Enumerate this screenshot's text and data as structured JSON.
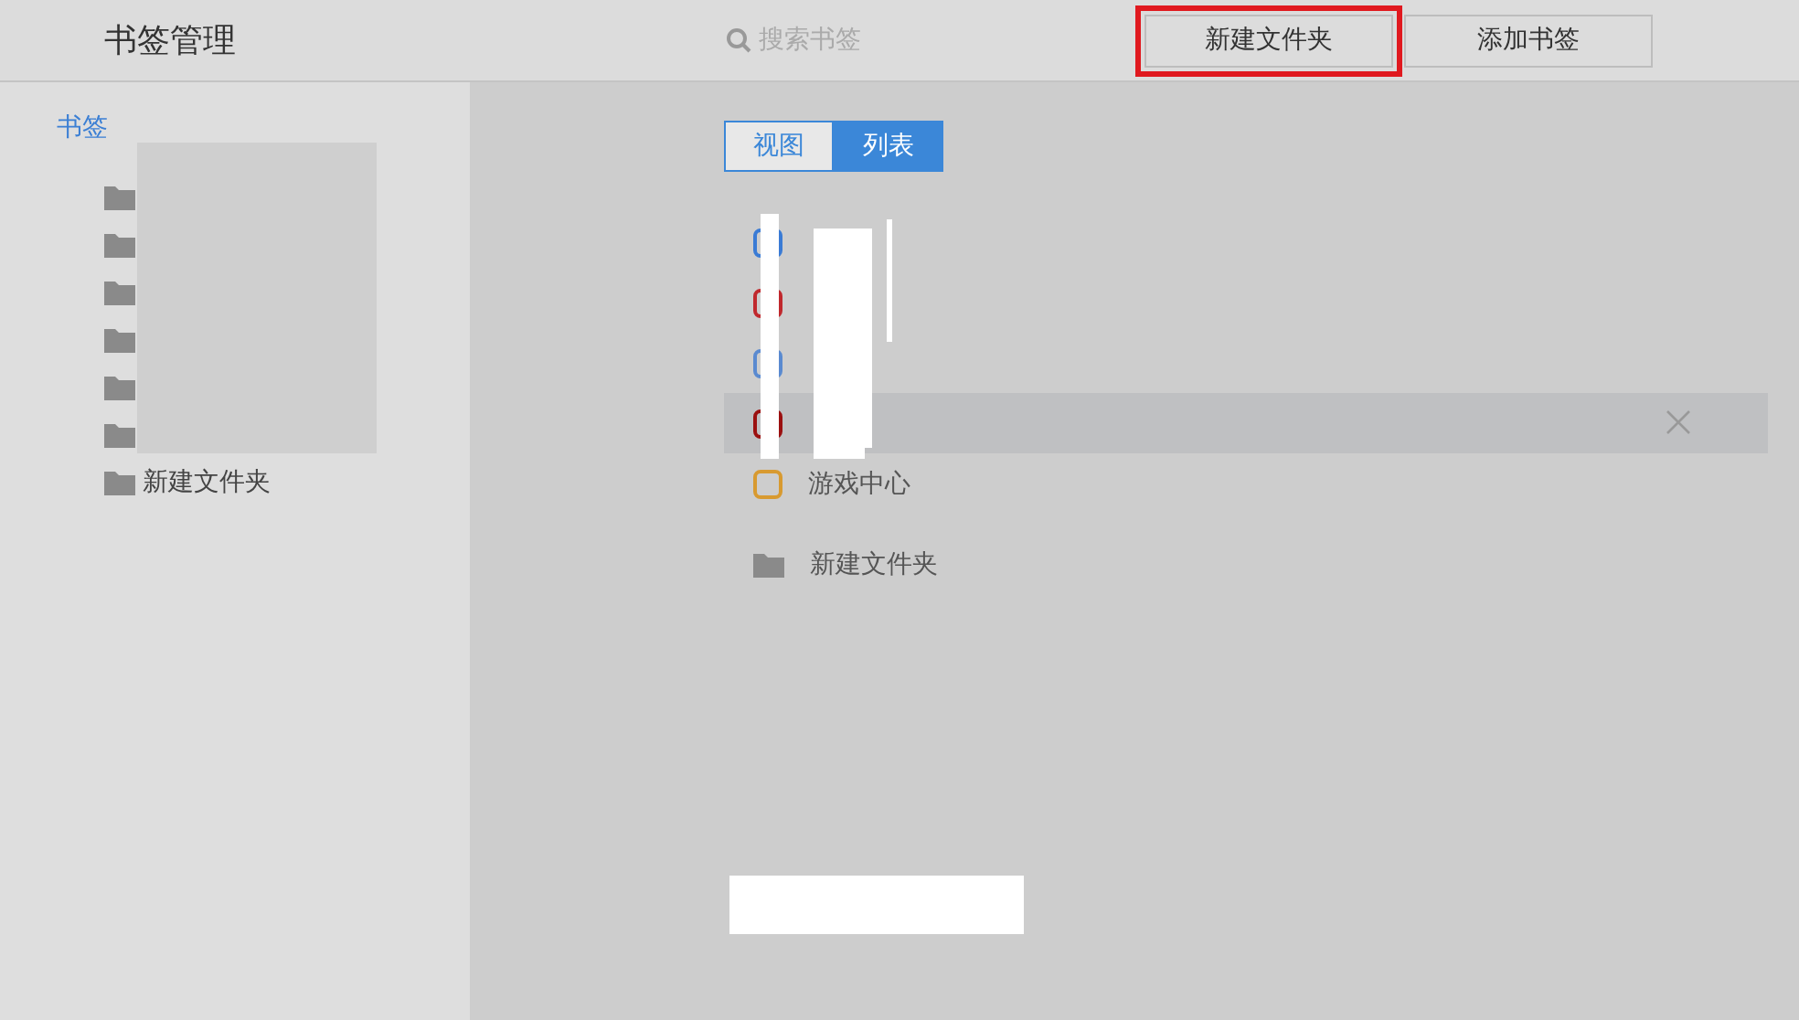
{
  "header": {
    "title": "书签管理",
    "search": {
      "placeholder": "搜索书签"
    },
    "buttons": [
      {
        "label": "新建文件夹",
        "highlighted": true
      },
      {
        "label": "添加书签",
        "highlighted": false
      }
    ]
  },
  "sidebar": {
    "root": "书签",
    "folders": [
      {
        "kind": "hidden"
      },
      {
        "kind": "hidden"
      },
      {
        "kind": "hidden"
      },
      {
        "kind": "hidden"
      },
      {
        "kind": "hidden"
      },
      {
        "kind": "hidden"
      },
      {
        "kind": "named",
        "name": "新建文件夹"
      }
    ]
  },
  "view_toggle": [
    {
      "label": "视图",
      "selected": false
    },
    {
      "label": "列表",
      "selected": true
    }
  ],
  "bookmarks": [
    {
      "kind": "site",
      "color": "#3a7bd5",
      "hovered": false
    },
    {
      "kind": "site",
      "color": "#c0282d",
      "hovered": false
    },
    {
      "kind": "site",
      "color": "#5a8ad0",
      "hovered": false
    },
    {
      "kind": "site",
      "color": "#9b1010",
      "hovered": true
    },
    {
      "kind": "site",
      "color": "#d89a30",
      "name": "游戏中心",
      "hovered": false
    },
    {
      "kind": "folder",
      "name": "新建文件夹",
      "hovered": false
    }
  ]
}
